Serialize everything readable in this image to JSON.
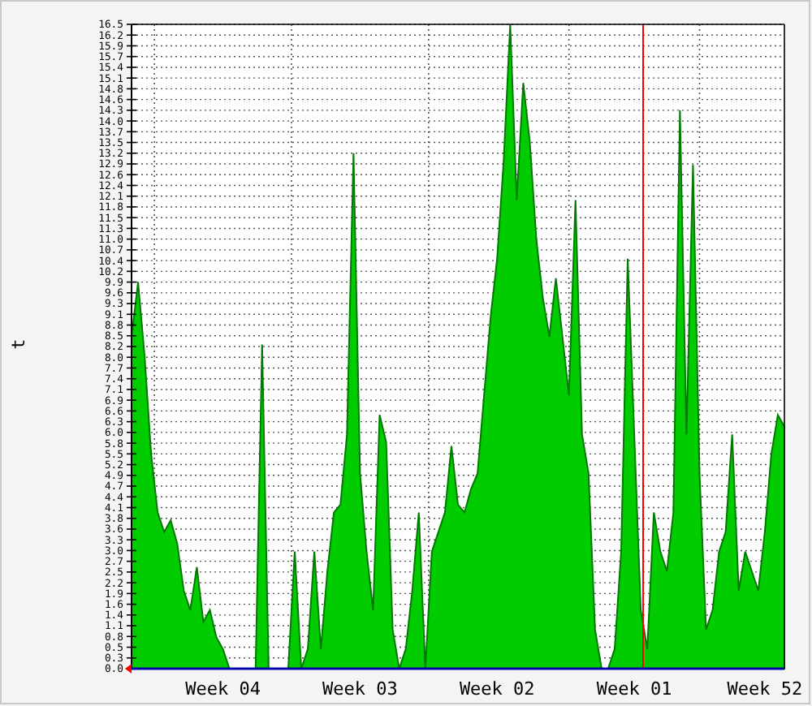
{
  "chart_data": {
    "type": "area",
    "ylabel": "t",
    "categories": [
      null,
      null,
      null,
      null,
      null,
      null,
      null,
      null,
      null,
      null,
      null,
      null,
      null,
      null,
      "Week 04",
      null,
      null,
      null,
      null,
      null,
      null,
      null,
      null,
      null,
      null,
      null,
      null,
      null,
      null,
      null,
      null,
      null,
      null,
      null,
      null,
      "Week 03",
      null,
      null,
      null,
      null,
      null,
      null,
      null,
      null,
      null,
      null,
      null,
      null,
      null,
      null,
      null,
      null,
      null,
      null,
      null,
      null,
      "Week 02",
      null,
      null,
      null,
      null,
      null,
      null,
      null,
      null,
      null,
      null,
      null,
      null,
      null,
      null,
      null,
      null,
      null,
      null,
      null,
      null,
      "Week 01",
      null,
      null,
      null,
      null,
      null,
      null,
      null,
      null,
      null,
      null,
      null,
      null,
      null,
      null,
      null,
      null,
      null,
      null,
      null,
      "Week 52",
      null,
      null,
      null
    ],
    "series": [
      {
        "color": "#00cc00",
        "values": [
          8.5,
          9.9,
          8,
          5.5,
          4,
          3.5,
          3.8,
          3.2,
          2,
          1.5,
          2.6,
          1.2,
          1.5,
          0.8,
          0.5,
          0,
          0,
          0,
          0,
          0,
          8.3,
          0,
          0,
          0,
          0,
          3,
          0,
          0.5,
          3,
          0.5,
          2.5,
          4,
          4.2,
          6,
          13.2,
          5,
          3,
          1.5,
          6.5,
          5.8,
          1,
          0,
          0.5,
          2,
          4,
          0,
          3,
          3.5,
          4,
          5.7,
          4.2,
          4,
          4.6,
          5,
          7,
          9,
          10.5,
          13,
          16.5,
          12,
          15,
          13.5,
          11,
          9.5,
          8.5,
          10,
          8.5,
          7,
          12,
          6,
          5,
          1,
          0,
          0,
          0.5,
          3,
          10.5,
          6,
          1.5,
          0.5,
          4,
          3,
          2.5,
          4,
          14.3,
          6,
          12.9,
          5,
          1,
          1.5,
          3,
          3.5,
          6,
          2,
          3,
          2.5,
          2,
          3.5,
          5.5,
          6.5,
          6.2
        ]
      }
    ],
    "ylim": [
      0,
      16.5
    ],
    "yticks": [
      {
        "value": 0,
        "label": "0.0"
      },
      {
        "value": 0.275,
        "label": "0.3"
      },
      {
        "value": 0.55,
        "label": "0.5"
      },
      {
        "value": 0.825,
        "label": "0.8"
      },
      {
        "value": 1.1,
        "label": "1.1"
      },
      {
        "value": 1.375,
        "label": "1.4"
      },
      {
        "value": 1.65,
        "label": "1.6"
      },
      {
        "value": 1.925,
        "label": "1.9"
      },
      {
        "value": 2.2,
        "label": "2.2"
      },
      {
        "value": 2.475,
        "label": "2.5"
      },
      {
        "value": 2.75,
        "label": "2.7"
      },
      {
        "value": 3.025,
        "label": "3.0"
      },
      {
        "value": 3.3,
        "label": "3.3"
      },
      {
        "value": 3.575,
        "label": "3.6"
      },
      {
        "value": 3.85,
        "label": "3.8"
      },
      {
        "value": 4.125,
        "label": "4.1"
      },
      {
        "value": 4.4,
        "label": "4.4"
      },
      {
        "value": 4.675,
        "label": "4.7"
      },
      {
        "value": 4.95,
        "label": "4.9"
      },
      {
        "value": 5.225,
        "label": "5.2"
      },
      {
        "value": 5.5,
        "label": "5.5"
      },
      {
        "value": 5.775,
        "label": "5.8"
      },
      {
        "value": 6.05,
        "label": "6.0"
      },
      {
        "value": 6.325,
        "label": "6.3"
      },
      {
        "value": 6.6,
        "label": "6.6"
      },
      {
        "value": 6.875,
        "label": "6.9"
      },
      {
        "value": 7.15,
        "label": "7.1"
      },
      {
        "value": 7.425,
        "label": "7.4"
      },
      {
        "value": 7.7,
        "label": "7.7"
      },
      {
        "value": 7.975,
        "label": "8.0"
      },
      {
        "value": 8.25,
        "label": "8.2"
      },
      {
        "value": 8.525,
        "label": "8.5"
      },
      {
        "value": 8.8,
        "label": "8.8"
      },
      {
        "value": 9.075,
        "label": "9.1"
      },
      {
        "value": 9.35,
        "label": "9.3"
      },
      {
        "value": 9.625,
        "label": "9.6"
      },
      {
        "value": 9.9,
        "label": "9.9"
      },
      {
        "value": 10.175,
        "label": "10.2"
      },
      {
        "value": 10.45,
        "label": "10.4"
      },
      {
        "value": 10.725,
        "label": "10.7"
      },
      {
        "value": 11,
        "label": "11.0"
      },
      {
        "value": 11.275,
        "label": "11.3"
      },
      {
        "value": 11.55,
        "label": "11.5"
      },
      {
        "value": 11.825,
        "label": "11.8"
      },
      {
        "value": 12.1,
        "label": "12.1"
      },
      {
        "value": 12.375,
        "label": "12.4"
      },
      {
        "value": 12.65,
        "label": "12.6"
      },
      {
        "value": 12.925,
        "label": "12.9"
      },
      {
        "value": 13.2,
        "label": "13.2"
      },
      {
        "value": 13.475,
        "label": "13.5"
      },
      {
        "value": 13.75,
        "label": "13.7"
      },
      {
        "value": 14.025,
        "label": "14.0"
      },
      {
        "value": 14.3,
        "label": "14.3"
      },
      {
        "value": 14.575,
        "label": "14.6"
      },
      {
        "value": 14.85,
        "label": "14.8"
      },
      {
        "value": 15.125,
        "label": "15.1"
      },
      {
        "value": 15.4,
        "label": "15.4"
      },
      {
        "value": 15.675,
        "label": "15.7"
      },
      {
        "value": 15.95,
        "label": "15.9"
      },
      {
        "value": 16.225,
        "label": "16.2"
      },
      {
        "value": 16.5,
        "label": "16.5"
      }
    ],
    "grid": true
  }
}
